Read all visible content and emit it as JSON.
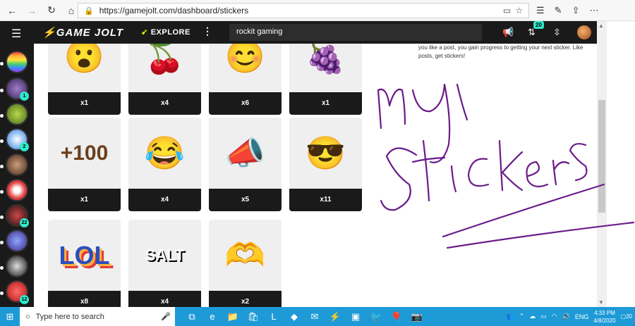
{
  "browser": {
    "url": "https://gamejolt.com/dashboard/stickers",
    "back_icon": "back-arrow-icon",
    "forward_icon": "forward-arrow-icon"
  },
  "header": {
    "logo_text": "GAME JOLT",
    "explore_label": "EXPLORE",
    "search_value": "rockit gaming",
    "notification_count": "20"
  },
  "sidebar": {
    "badges": [
      "1",
      "2",
      "22",
      "12"
    ]
  },
  "intro_text": "you like a post, you gain progress to getting your next sticker. Like posts, get stickers!",
  "stickers": {
    "row1": [
      {
        "glyph": "😮",
        "count": "x1",
        "color": "#ffb23c"
      },
      {
        "glyph": "🍒",
        "count": "x4",
        "color": "#4aa7ff"
      },
      {
        "glyph": "😊",
        "count": "x6",
        "color": "#4aa7ff"
      },
      {
        "glyph": "🍇",
        "count": "x1",
        "color": "#74ff4a"
      }
    ],
    "row2": [
      {
        "glyph": "+100",
        "count": "x1",
        "color": "#74ff4a"
      },
      {
        "glyph": "😂",
        "count": "x4",
        "color": "#74ff4a"
      },
      {
        "glyph": "📣",
        "count": "x5",
        "color": "#ffffff"
      },
      {
        "glyph": "😎",
        "count": "x11",
        "color": "#ffffff"
      }
    ],
    "row3": [
      {
        "glyph": "LOL",
        "count": "x8",
        "color": "#ffffff"
      },
      {
        "glyph": "SALT",
        "count": "x4",
        "color": "#ffffff"
      },
      {
        "glyph": "🫶",
        "count": "x2",
        "color": "#ffffff"
      }
    ]
  },
  "taskbar": {
    "search_placeholder": "Type here to search",
    "language": "ENG",
    "time": "4:33 PM",
    "date": "4/8/2020",
    "notification_count": "20"
  },
  "colors": {
    "header_bg": "#1a1a1a",
    "accent": "#2eeacc",
    "taskbar": "#1e9ad6",
    "doodle": "#6a1b8a"
  }
}
